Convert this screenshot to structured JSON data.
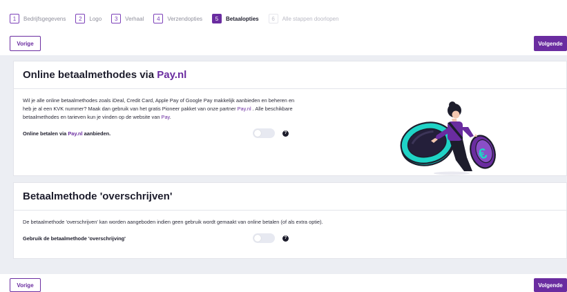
{
  "steps": [
    {
      "num": "1",
      "label": "Bedrijfsgegevens"
    },
    {
      "num": "2",
      "label": "Logo"
    },
    {
      "num": "3",
      "label": "Verhaal"
    },
    {
      "num": "4",
      "label": "Verzendopties"
    },
    {
      "num": "5",
      "label": "Betaalopties"
    },
    {
      "num": "6",
      "label": "Alle stappen doorlopen"
    }
  ],
  "nav": {
    "prev": "Vorige",
    "next": "Volgende"
  },
  "online": {
    "title": "Online betaalmethodes via ",
    "title_accent": "Pay.nl",
    "para_1": "Wil je alle online betaalmethodes zoals iDeal, Credit Card, Apple Pay of Google Pay makkelijk aanbieden en beheren en heb je al een KVK nummer? Maak dan gebruik van het gratis Pioneer pakket van onze partner ",
    "para_link_1": "Pay.nl",
    "para_2": " . Alle beschikbare betaalmethodes en tarieven kun je vinden op de website van ",
    "para_link_2": "Pay",
    "para_end": ".",
    "option_pre": "Online betalen via ",
    "option_link": "Pay.nl",
    "option_post": " aanbieden.",
    "help": "?"
  },
  "transfer": {
    "title": "Betaalmethode 'overschrijven'",
    "para": "De betaalmethode 'overschrijven' kan worden aangeboden indien geen gebruik wordt gemaakt van online betalen (of als extra optie).",
    "option": "Gebruik de betaalmethode 'overschrijving'",
    "help": "?"
  },
  "colors": {
    "accent": "#6a2ca0",
    "coin": "#1fd3c6",
    "background": "#eceef3"
  }
}
